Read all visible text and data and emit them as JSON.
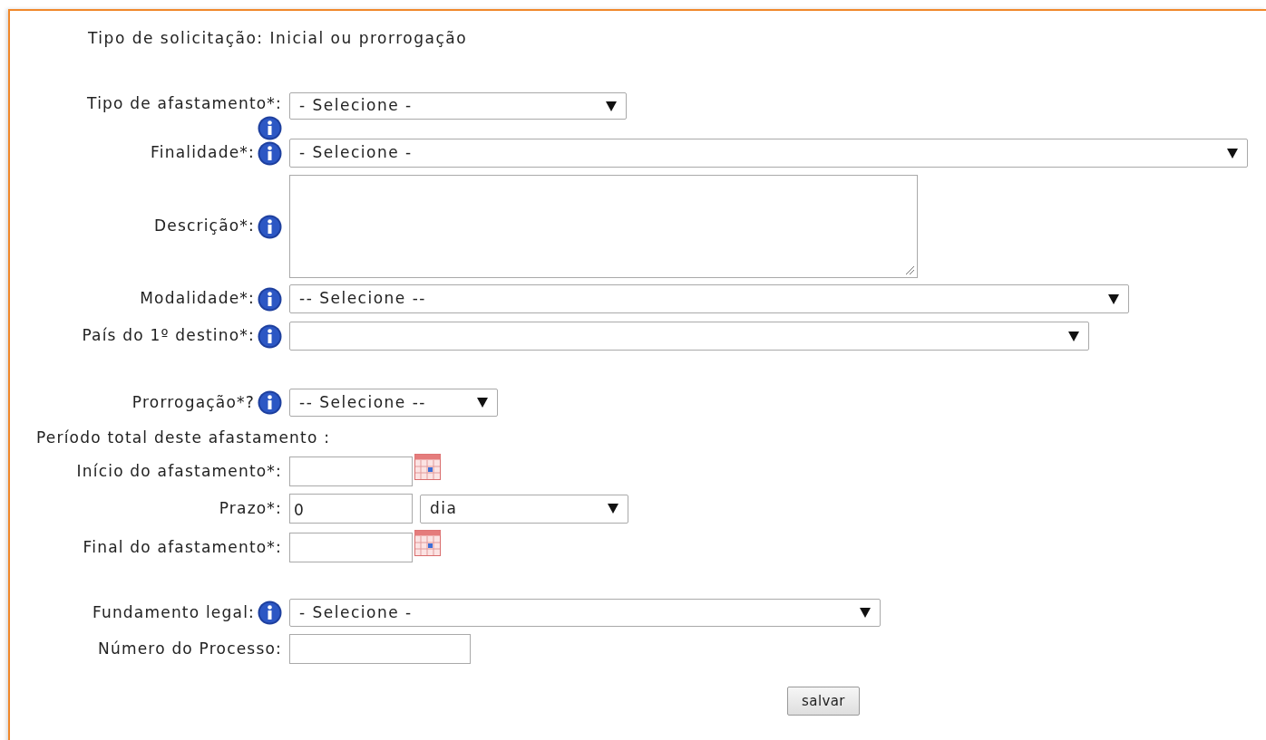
{
  "request_type": "Tipo de solicitação: Inicial ou prorrogação",
  "rows": [
    {
      "kind": "select",
      "label": "Tipo de afastamento*:",
      "info": true,
      "value": "- Selecione -"
    },
    {
      "kind": "select",
      "label": "Finalidade*:",
      "info": true,
      "value": "- Selecione -"
    },
    {
      "kind": "textarea",
      "label": "Descrição*:",
      "info": true
    },
    {
      "kind": "select",
      "label": "Modalidade*:",
      "info": true,
      "value": "-- Selecione --"
    },
    {
      "kind": "select",
      "label": "País do 1º destino*:",
      "info": true
    },
    {
      "kind": "select",
      "label": "Prorrogação*?",
      "info": true,
      "value": "-- Selecione --"
    },
    {
      "kind": "heading",
      "label": "Período total deste afastamento :"
    },
    {
      "kind": "date",
      "label": "Início do afastamento*:",
      "info": false
    },
    {
      "kind": "duration",
      "label": "Prazo*:",
      "info": false,
      "value": "0",
      "unit": "dia"
    },
    {
      "kind": "date",
      "label": "Final do afastamento*:",
      "info": false
    },
    {
      "kind": "select",
      "label": "Fundamento legal:",
      "info": true,
      "value": "- Selecione -"
    },
    {
      "kind": "text",
      "label": "Número do Processo:",
      "info": false
    }
  ],
  "save_button": "salvar"
}
